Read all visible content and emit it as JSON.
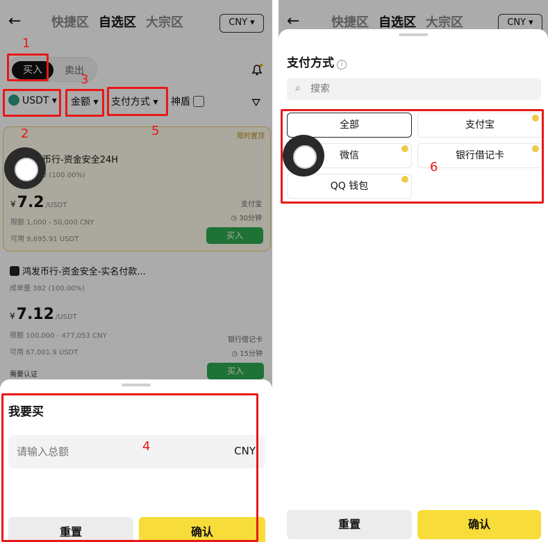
{
  "header": {
    "tabs": [
      "快捷区",
      "自选区",
      "大宗区"
    ],
    "active_tab": "自选区",
    "currency": "CNY"
  },
  "left": {
    "buy_label": "买入",
    "sell_label": "卖出",
    "filters": {
      "coin": "USDT",
      "amount": "金额",
      "payment": "支付方式",
      "shield": "神盾"
    },
    "cards": [
      {
        "badge": "限时置顶",
        "merchant": "币行-资金安全24H",
        "completion": "3 (100.00%)",
        "currency_symbol": "¥",
        "price": "7.2",
        "unit": "/USDT",
        "limit": "限额 1,000 - 50,000 CNY",
        "available": "可用 9,695.91 USDT",
        "payment": "支付宝",
        "time": "30分钟",
        "action": "买入"
      },
      {
        "merchant": "鸿发币行-资金安全-实名付款...",
        "completion": "成单量 382 (100.00%)",
        "currency_symbol": "¥",
        "price": "7.12",
        "unit": "/USDT",
        "limit": "限额 100,000 - 477,053 CNY",
        "available": "可用 67,001.9 USDT",
        "payment": "银行借记卡",
        "time": "15分钟",
        "verify": "需要认证",
        "action": "买入"
      }
    ],
    "sheet": {
      "title": "我要买",
      "amount_placeholder": "请输入总额",
      "amount_unit": "CNY",
      "reset": "重置",
      "confirm": "确认"
    }
  },
  "right": {
    "title": "支付方式",
    "search_placeholder": "搜索",
    "options": [
      "全部",
      "支付宝",
      "微信",
      "银行借记卡",
      "QQ 钱包"
    ],
    "selected": "全部",
    "reset": "重置",
    "confirm": "确认"
  },
  "annotations": [
    "1",
    "2",
    "3",
    "4",
    "5",
    "6"
  ],
  "colors": {
    "annotation": "#e81818",
    "confirm": "#f7dc3a",
    "buy": "#2eaa4f"
  }
}
